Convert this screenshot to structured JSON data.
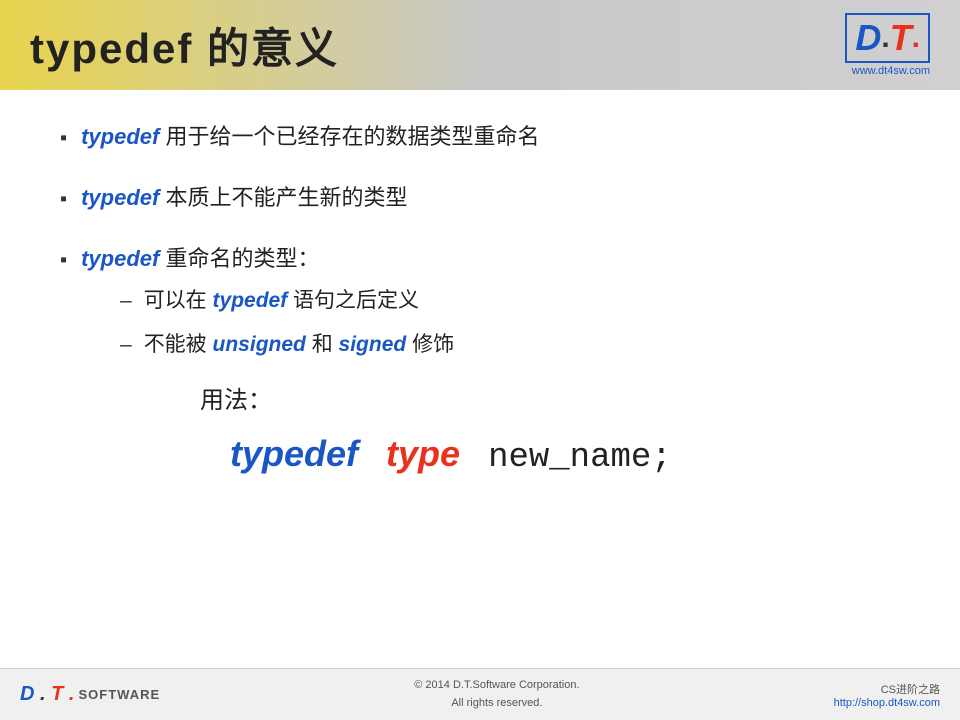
{
  "header": {
    "title": "typedef 的意义",
    "logo": {
      "d": "D",
      "dot1": ".",
      "t": "T",
      "dot2": ".",
      "url": "www.dt4sw.com"
    }
  },
  "bullets": [
    {
      "id": "bullet1",
      "text_prefix": "typedef",
      "text_rest": " 用于给一个已经存在的数据类型重命名"
    },
    {
      "id": "bullet2",
      "text_prefix": "typedef",
      "text_rest": " 本质上不能产生新的类型"
    },
    {
      "id": "bullet3",
      "text_prefix": "typedef",
      "text_rest": " 重命名的类型："
    }
  ],
  "sub_bullets": [
    {
      "id": "sub1",
      "text": "可以在 typedef 语句之后定义",
      "keyword": "typedef"
    },
    {
      "id": "sub2",
      "text": "不能被 unsigned 和 signed 修饰",
      "keywords": [
        "unsigned",
        "signed"
      ]
    }
  ],
  "usage": {
    "label": "用法：",
    "typedef": "typedef",
    "type": "type",
    "new_name": "new_name;"
  },
  "footer": {
    "logo_d": "D",
    "logo_dot1": ".",
    "logo_t": "T",
    "logo_dot2": ".",
    "software": "Software",
    "copyright_line1": "© 2014 D.T.Software Corporation.",
    "copyright_line2": "All rights reserved.",
    "page_info": "CS进阶之路 - http://shop.dt4sw.com",
    "url": "http://shop.dt4sw.com"
  }
}
